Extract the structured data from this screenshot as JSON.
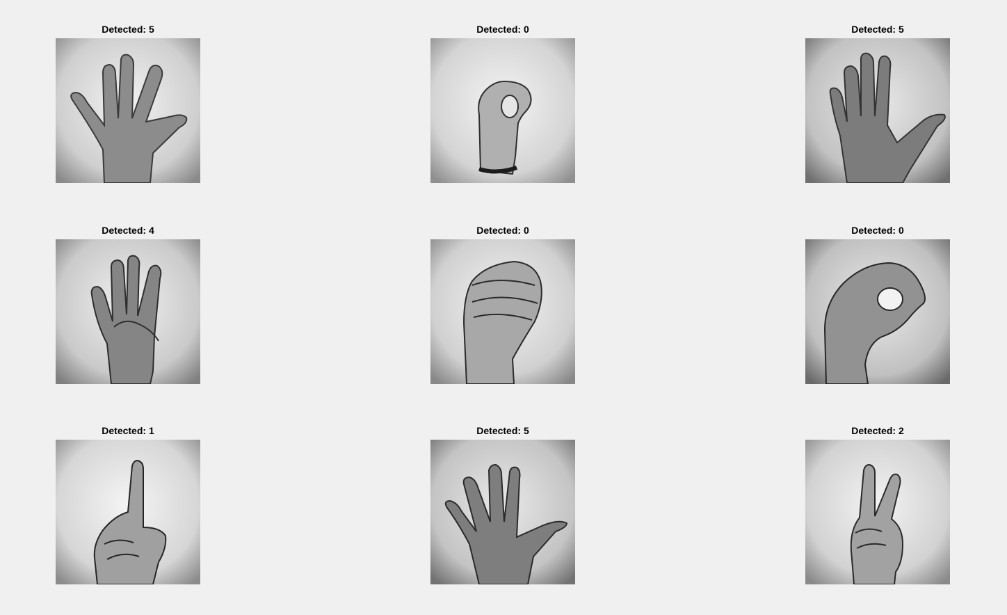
{
  "figure": {
    "background": "#f0f0f0",
    "panels": [
      {
        "title": "Detected: 5",
        "gesture": "hand-open-five-icon"
      },
      {
        "title": "Detected: 0",
        "gesture": "hand-ok-circle-icon"
      },
      {
        "title": "Detected: 5",
        "gesture": "hand-open-five-icon"
      },
      {
        "title": "Detected: 4",
        "gesture": "hand-four-fingers-icon"
      },
      {
        "title": "Detected: 0",
        "gesture": "hand-fist-icon"
      },
      {
        "title": "Detected: 0",
        "gesture": "hand-ok-circle-icon"
      },
      {
        "title": "Detected: 1",
        "gesture": "hand-index-up-icon"
      },
      {
        "title": "Detected: 5",
        "gesture": "hand-open-five-icon"
      },
      {
        "title": "Detected: 2",
        "gesture": "hand-victory-icon"
      }
    ]
  }
}
